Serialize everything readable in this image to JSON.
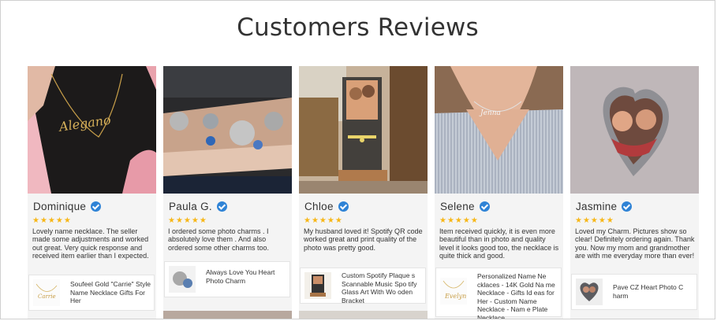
{
  "page": {
    "title": "Customers Reviews"
  },
  "colors": {
    "star": "#f7b718",
    "verified": "#2f83d6",
    "card_bg": "#f4f4f4"
  },
  "reviews": [
    {
      "name": "Dominique",
      "rating": 5,
      "stars": "★★★★★",
      "text": "Lovely name necklace. The seller made some adjustments and worked out great. Very quick response and received item earlier than I expected.",
      "product": "Soufeel Gold \"Carrie\" Style Name Necklace Gifts For Her"
    },
    {
      "name": "Paula G.",
      "rating": 5,
      "stars": "★★★★★",
      "text": "I ordered some photo charms . I absolutely love them . And also ordered some other charms too.",
      "product": "Always Love You Heart Photo Charm"
    },
    {
      "name": "Chloe",
      "rating": 5,
      "stars": "★★★★★",
      "text": "My husband loved it! Spotify QR code worked great and print quality of the photo was pretty good.",
      "product": "Custom Spotify Plaque s Scannable Music Spo tify Glass Art With Wo oden Bracket"
    },
    {
      "name": "Selene",
      "rating": 5,
      "stars": "★★★★★",
      "text": "Item received quickly, it is even more beautiful than in photo and quality level it looks good too, the necklace is quite thick and good.",
      "product": "Personalized Name Ne cklaces - 14K Gold Na me Necklace - Gifts Id eas for Her - Custom Name Necklace - Nam e Plate Necklace"
    },
    {
      "name": "Jasmine",
      "rating": 5,
      "stars": "★★★★★",
      "text": "Loved my Charm. Pictures show so clear! Definitely ordering again. Thank you. Now my mom and grandmother are with me everyday more than ever!",
      "product": "Pave CZ Heart Photo C harm"
    }
  ]
}
